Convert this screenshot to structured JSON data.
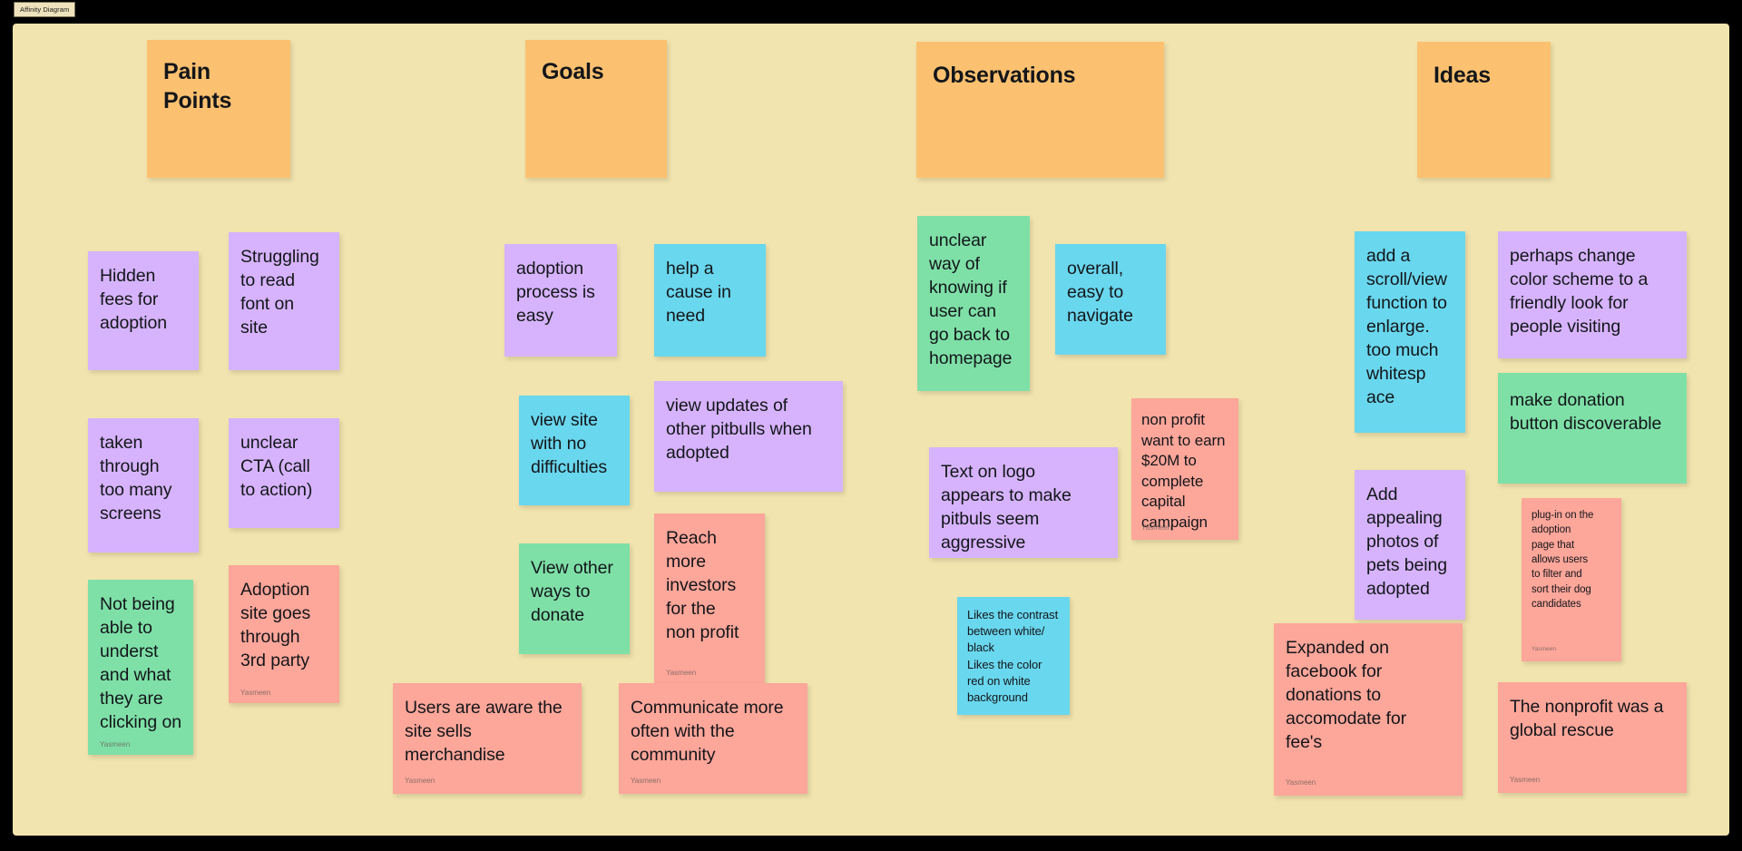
{
  "window": {
    "app_tab_label": "Affinity Diagram",
    "canvas_color": "#f2e4ae",
    "backdrop_color": "#000000"
  },
  "palette": {
    "orange": "#fcc170",
    "purple": "#d6b3fc",
    "blue": "#69d7ee",
    "green": "#7ee0a7",
    "red": "#fda69a"
  },
  "headers": [
    {
      "id": "pain-points",
      "text": "Pain\nPoints",
      "color": "#fcc170"
    },
    {
      "id": "goals",
      "text": "Goals",
      "color": "#fcc170"
    },
    {
      "id": "observations",
      "text": "Observations",
      "color": "#fcc170"
    },
    {
      "id": "ideas",
      "text": "Ideas",
      "color": "#fcc170"
    }
  ],
  "notes": [
    {
      "id": "n01",
      "text": "Hidden\nfees for\nadoption",
      "color": "purple",
      "author": ""
    },
    {
      "id": "n02",
      "text": "Struggling\nto read\nfont on\nsite",
      "color": "purple",
      "author": ""
    },
    {
      "id": "n03",
      "text": "taken\nthrough\ntoo many\nscreens",
      "color": "purple",
      "author": ""
    },
    {
      "id": "n04",
      "text": "unclear\nCTA (call\nto action)",
      "color": "purple",
      "author": ""
    },
    {
      "id": "n05",
      "text": "Not being\nable to\nunderst\nand what\nthey are\nclicking on",
      "color": "green",
      "author": "Yasmeen"
    },
    {
      "id": "n06",
      "text": "Adoption\nsite goes\nthrough\n3rd party",
      "color": "red",
      "author": "Yasmeen"
    },
    {
      "id": "n07",
      "text": "adoption\nprocess is\neasy",
      "color": "purple",
      "author": ""
    },
    {
      "id": "n08",
      "text": "help a\ncause in\nneed",
      "color": "blue",
      "author": ""
    },
    {
      "id": "n09",
      "text": "view site\nwith no\ndifficulties",
      "color": "blue",
      "author": ""
    },
    {
      "id": "n10",
      "text": "view updates of\nother pitbulls when\nadopted",
      "color": "purple",
      "author": ""
    },
    {
      "id": "n11",
      "text": "View other\nways to\ndonate",
      "color": "green",
      "author": ""
    },
    {
      "id": "n12",
      "text": "Reach\nmore\ninvestors\nfor the\nnon profit",
      "color": "red",
      "author": "Yasmeen"
    },
    {
      "id": "n13",
      "text": "Users are aware the\nsite sells\nmerchandise",
      "color": "red",
      "author": "Yasmeen"
    },
    {
      "id": "n14",
      "text": "Communicate more\noften with the\ncommunity",
      "color": "red",
      "author": "Yasmeen"
    },
    {
      "id": "n15",
      "text": "unclear\nway of\nknowing if\nuser can\ngo back to\nhomepage",
      "color": "green",
      "author": ""
    },
    {
      "id": "n16",
      "text": "overall,\neasy to\nnavigate",
      "color": "blue",
      "author": ""
    },
    {
      "id": "n17",
      "text": "non profit\nwant to earn\n$20M to\ncomplete\ncapital\ncampaign",
      "color": "red",
      "author": "Yasmeen"
    },
    {
      "id": "n18",
      "text": "Text on logo\nappears to make\npitbuls seem\naggressive",
      "color": "purple",
      "author": ""
    },
    {
      "id": "n19",
      "text": "Likes the contrast\nbetween white/\nblack\nLikes the color\nred on white\nbackground",
      "color": "blue",
      "author": ""
    },
    {
      "id": "n20",
      "text": "add a\nscroll/view\nfunction to\nenlarge.\ntoo much\nwhitesp\nace",
      "color": "blue",
      "author": ""
    },
    {
      "id": "n21",
      "text": "perhaps change\ncolor scheme to a\nfriendly look for\npeople visiting",
      "color": "purple",
      "author": ""
    },
    {
      "id": "n22",
      "text": "make donation\nbutton discoverable",
      "color": "green",
      "author": ""
    },
    {
      "id": "n23",
      "text": "Add\nappealing\nphotos of\npets being\nadopted",
      "color": "purple",
      "author": ""
    },
    {
      "id": "n24",
      "text": "plug-in on the\nadoption\npage that\nallows users\nto filter and\nsort their dog\ncandidates",
      "color": "red",
      "author": "Yasmeen"
    },
    {
      "id": "n25",
      "text": "Expanded on\nfacebook for\ndonations to\naccomodate for\nfee's",
      "color": "red",
      "author": "Yasmeen"
    },
    {
      "id": "n26",
      "text": "The nonprofit was a\nglobal rescue",
      "color": "red",
      "author": "Yasmeen"
    }
  ]
}
